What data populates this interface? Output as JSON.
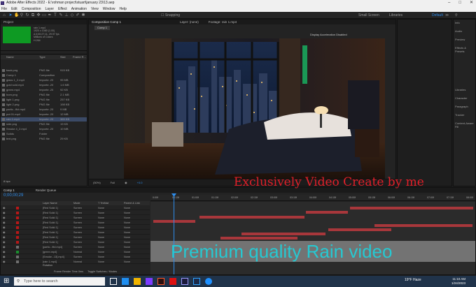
{
  "app": {
    "title": "Adobe After Effects 2022 - E:\\rohman project\\stuart\\january 23\\13.aep",
    "logo": "Ae",
    "menu": [
      "File",
      "Edit",
      "Composition",
      "Layer",
      "Effect",
      "Animation",
      "View",
      "Window",
      "Help"
    ]
  },
  "toolbar": {
    "snapping": "Snapping",
    "workspaces": [
      "Small Screen",
      "Libraries",
      "Default"
    ],
    "search_placeholder": "Search Help"
  },
  "project": {
    "tab": "Project",
    "preview_name": "rain 1.mp4",
    "preview_meta": [
      "1920 x 1080 (1.00)",
      "Δ 0;00;27;11, 29.97 fps",
      "Millions of Colors",
      "H.264"
    ],
    "columns": [
      "Name",
      "Type",
      "Size",
      "Frame R..."
    ],
    "items": [
      {
        "name": "back.png",
        "type": "PNG file",
        "size": "915 KB"
      },
      {
        "name": "Comp 1",
        "type": "Composition",
        "size": ""
      },
      {
        "name": "glass 1_2.mp4",
        "type": "Importe..20",
        "size": "95 MB"
      },
      {
        "name": "gold sold.mp4",
        "type": "Importe..20",
        "size": "1.6 MB"
      },
      {
        "name": "green.mp4",
        "type": "Importe..20",
        "size": "92 KB"
      },
      {
        "name": "horn.png",
        "type": "PNG file",
        "size": "2.1 MB"
      },
      {
        "name": "light 1.png",
        "type": "PNG file",
        "size": "257 KB"
      },
      {
        "name": "light 2.png",
        "type": "PNG file",
        "size": "198 KB"
      },
      {
        "name": "partic...ffct.mp4",
        "type": "Importe..20",
        "size": "9 MB"
      },
      {
        "name": "pot 01.mp4",
        "type": "Importe..20",
        "size": "12 MB"
      },
      {
        "name": "rain 1.mp4",
        "type": "Importe..20",
        "size": "365 KB"
      },
      {
        "name": "side.png",
        "type": "PNG file",
        "size": "19 KB"
      },
      {
        "name": "Smoke 4_2.mp4",
        "type": "Importe..20",
        "size": "10 MB"
      },
      {
        "name": "Solids",
        "type": "Folder",
        "size": ""
      },
      {
        "name": "text.png",
        "type": "PNG file",
        "size": "29 KB"
      }
    ],
    "footer": "8 bpc"
  },
  "viewer": {
    "tabs": [
      "Composition Comp 1",
      "Layer: (none)",
      "Footage: rain 1.mp4"
    ],
    "comp_tab": "Comp 1",
    "notice": "Display Acceleration Disabled",
    "footer": [
      "(50%)",
      "Full",
      "+0.0"
    ]
  },
  "right_panel": {
    "items": [
      "Info",
      "Audio",
      "Preview",
      "Effects & Presets",
      "Libraries",
      "Character",
      "Paragraph",
      "Tracker",
      "Content-Aware Fill"
    ]
  },
  "timeline": {
    "tabs": [
      "Comp 1",
      "Render Queue"
    ],
    "timecode": "0;00;00;29",
    "columns": [
      "Layer Name",
      "Mode",
      "T TrkMat",
      "Parent & Link"
    ],
    "layers": [
      {
        "name": "[Red Solid 1]",
        "mode": "Screen",
        "trkmat": "None",
        "parent": "None"
      },
      {
        "name": "[Red Solid 1]",
        "mode": "Screen",
        "trkmat": "None",
        "parent": "None"
      },
      {
        "name": "[Red Solid 1]",
        "mode": "Screen",
        "trkmat": "None",
        "parent": "None"
      },
      {
        "name": "[Red Solid 1]",
        "mode": "Screen",
        "trkmat": "None",
        "parent": "None"
      },
      {
        "name": "[Red Solid 1]",
        "mode": "Screen",
        "trkmat": "None",
        "parent": "None"
      },
      {
        "name": "[Red Solid 1]",
        "mode": "Screen",
        "trkmat": "None",
        "parent": "None"
      },
      {
        "name": "[Red Solid 1]",
        "mode": "Screen",
        "trkmat": "None",
        "parent": "None"
      },
      {
        "name": "[Red Solid 1]",
        "mode": "Screen",
        "trkmat": "None",
        "parent": "None"
      },
      {
        "name": "[partic...ffct.mp4]",
        "mode": "Screen",
        "trkmat": "None",
        "parent": "None"
      },
      {
        "name": "[green.mp4]",
        "mode": "Normal",
        "trkmat": "None",
        "parent": "None"
      },
      {
        "name": "[Smoke...13].mp4]",
        "mode": "Screen",
        "trkmat": "None",
        "parent": "None"
      },
      {
        "name": "[rain 1.mp4]",
        "mode": "Normal",
        "trkmat": "None",
        "parent": "None"
      }
    ],
    "sublabel": "Rotation",
    "footer": [
      "Frame Render Time  0ms",
      "Toggle Switches / Modes"
    ],
    "ruler": [
      "0:00f",
      "00:15f",
      "01:00f",
      "01:15f",
      "02:00f",
      "02:15f",
      "03:00f",
      "03:15f",
      "04:00f",
      "04:15f",
      "05:00f",
      "05:15f",
      "06:00f",
      "06:15f",
      "07:00f",
      "07:15f",
      "08:00f"
    ]
  },
  "overlays": {
    "red": "Exclusively Video Create by me",
    "cyan": "Premium quality Rain video"
  },
  "taskbar": {
    "search_placeholder": "Type here to search",
    "weather": "19°F Haze",
    "clock": [
      "11:10 AM",
      "1/24/2023"
    ]
  },
  "colors": {
    "accent_blue": "#2d8ceb",
    "layer_bar": "#a8373b",
    "overlay_red": "#e2202a",
    "overlay_cyan": "#26c9d2",
    "thumb_green": "#0e9a23"
  }
}
